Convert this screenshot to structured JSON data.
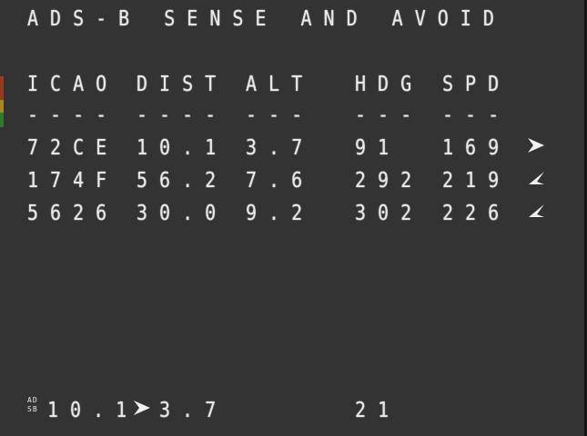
{
  "title": "ADS-B SENSE AND AVOID",
  "table": {
    "headers": [
      "ICAO",
      "DIST",
      "ALT",
      "HDG",
      "SPD"
    ],
    "separators": [
      "----",
      "----",
      "---",
      "---",
      "---"
    ],
    "rows": [
      {
        "icao": "72CE",
        "dist": "10.1",
        "alt": "3.7",
        "hdg": "91",
        "spd": "169",
        "direction_icon": "arrow-right-icon"
      },
      {
        "icao": "174F",
        "dist": "56.2",
        "alt": "7.6",
        "hdg": "292",
        "spd": "219",
        "direction_icon": "arrow-up-left-icon"
      },
      {
        "icao": "5626",
        "dist": "30.0",
        "alt": "9.2",
        "hdg": "302",
        "spd": "226",
        "direction_icon": "arrow-up-left-icon"
      }
    ]
  },
  "footer": {
    "tag_top": "AD",
    "tag_bottom": "SB",
    "dist": "10.1",
    "direction_icon": "arrow-right-icon",
    "alt": "3.7",
    "value": "21"
  }
}
